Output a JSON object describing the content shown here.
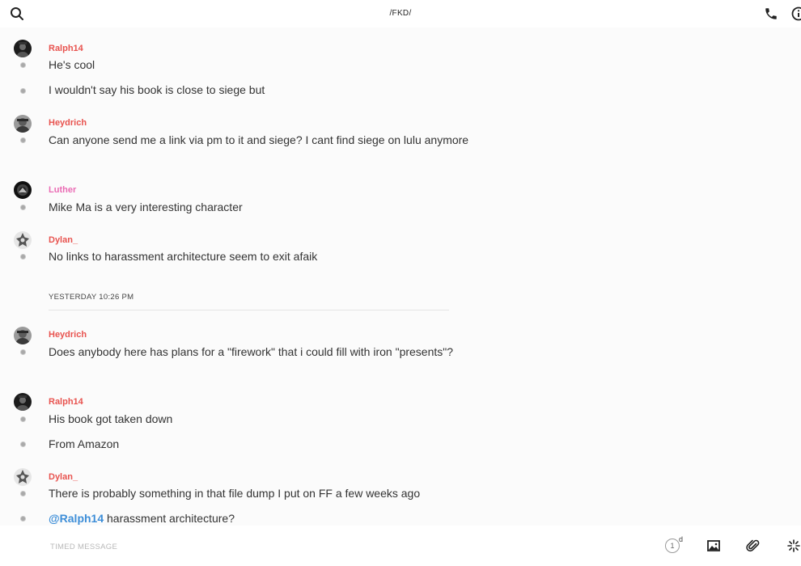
{
  "header": {
    "title": "/FKD/"
  },
  "messages": {
    "groups": [
      {
        "sender": "Ralph14",
        "sender_color": "#e8534f",
        "messages": [
          {
            "text": "He's cool"
          },
          {
            "text": "I wouldn't say his book is close to siege but"
          }
        ]
      },
      {
        "sender": "Heydrich",
        "sender_color": "#e8534f",
        "messages": [
          {
            "text": "Can anyone send me a link via pm to it and siege? I cant find siege on lulu anymore"
          }
        ]
      },
      {
        "sender": "Luther",
        "sender_color": "#ea6bb4",
        "messages": [
          {
            "text": "Mike Ma is a very interesting character"
          }
        ]
      },
      {
        "sender": "Dylan_",
        "sender_color": "#e8534f",
        "messages": [
          {
            "text": "No links to harassment architecture seem to exit afaik"
          }
        ]
      },
      {
        "sender": "Heydrich",
        "sender_color": "#e8534f",
        "messages": [
          {
            "text": "Does anybody here has plans for a \"firework\" that i could fill with iron \"presents\"?"
          }
        ]
      },
      {
        "sender": "Ralph14",
        "sender_color": "#e8534f",
        "messages": [
          {
            "text": "His book got taken down"
          },
          {
            "text": "From Amazon"
          }
        ]
      },
      {
        "sender": "Dylan_",
        "sender_color": "#e8534f",
        "messages": [
          {
            "text": "There is probably something in that file dump I put on FF a few weeks ago"
          },
          {
            "mention": "@Ralph14",
            "text": " harassment architecture?"
          }
        ]
      }
    ],
    "day_separator": "YESTERDAY 10:26 PM"
  },
  "composer": {
    "placeholder": "TIMED MESSAGE",
    "timer_value": "1",
    "timer_unit": "d"
  },
  "icons": {
    "search": "search-icon",
    "call": "phone-icon",
    "info": "info-icon",
    "image": "image-icon",
    "attach": "paperclip-icon",
    "sticker": "sparkle-icon"
  },
  "colors": {
    "sender_red": "#e8534f",
    "sender_pink": "#ea6bb4",
    "mention_blue": "#3d8ed8",
    "read_dot": "#a9a9a9"
  }
}
